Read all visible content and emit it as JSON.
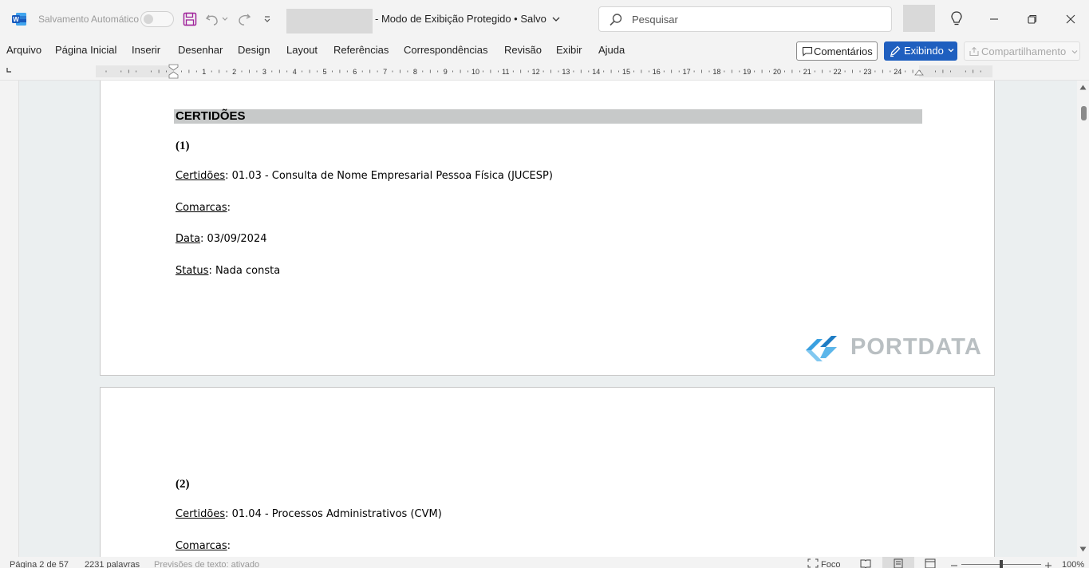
{
  "titlebar": {
    "autosave_label": "Salvamento Automático",
    "doc_title": "-  Modo de Exibição Protegido  •  Salvo",
    "search_placeholder": "Pesquisar"
  },
  "menu": {
    "items": [
      "Arquivo",
      "Página Inicial",
      "Inserir",
      "Desenhar",
      "Design",
      "Layout",
      "Referências",
      "Correspondências",
      "Revisão",
      "Exibir",
      "Ajuda"
    ],
    "comments_label": "Comentários",
    "viewing_label": "Exibindo",
    "share_label": "Compartilhamento"
  },
  "ruler": {
    "numbers": [
      "1",
      "2",
      "3",
      "4",
      "5",
      "6",
      "7",
      "8",
      "9",
      "10",
      "11",
      "12",
      "13",
      "14",
      "15",
      "16",
      "17",
      "18",
      "19",
      "20",
      "21",
      "22",
      "23",
      "24"
    ]
  },
  "document": {
    "heading": "CERTIDÕES",
    "entries": [
      {
        "number": "(1)",
        "certidoes_key": "Certidões",
        "certidoes_val": ": 01.03 - Consulta de Nome Empresarial Pessoa Física (JUCESP)",
        "comarcas_key": "Comarcas",
        "comarcas_val": ":",
        "data_key": "Data",
        "data_val": ": 03/09/2024",
        "status_key": "Status",
        "status_val": ": Nada consta"
      },
      {
        "number": "(2)",
        "certidoes_key": "Certidões",
        "certidoes_val": ": 01.04 - Processos Administrativos (CVM)",
        "comarcas_key": "Comarcas",
        "comarcas_val": ":"
      }
    ],
    "logo_text": "PORTDATA"
  },
  "status": {
    "page": "Página 2 de 57",
    "words": "2231 palavras",
    "predictions": "Previsões de texto: ativado",
    "focus": "Foco",
    "zoom": "100%"
  },
  "colors": {
    "accent": "#1f5fbf",
    "heading_bg": "#c7c9c9",
    "word_blue": "#185abd",
    "logo_blue": "#3aa0e0"
  }
}
